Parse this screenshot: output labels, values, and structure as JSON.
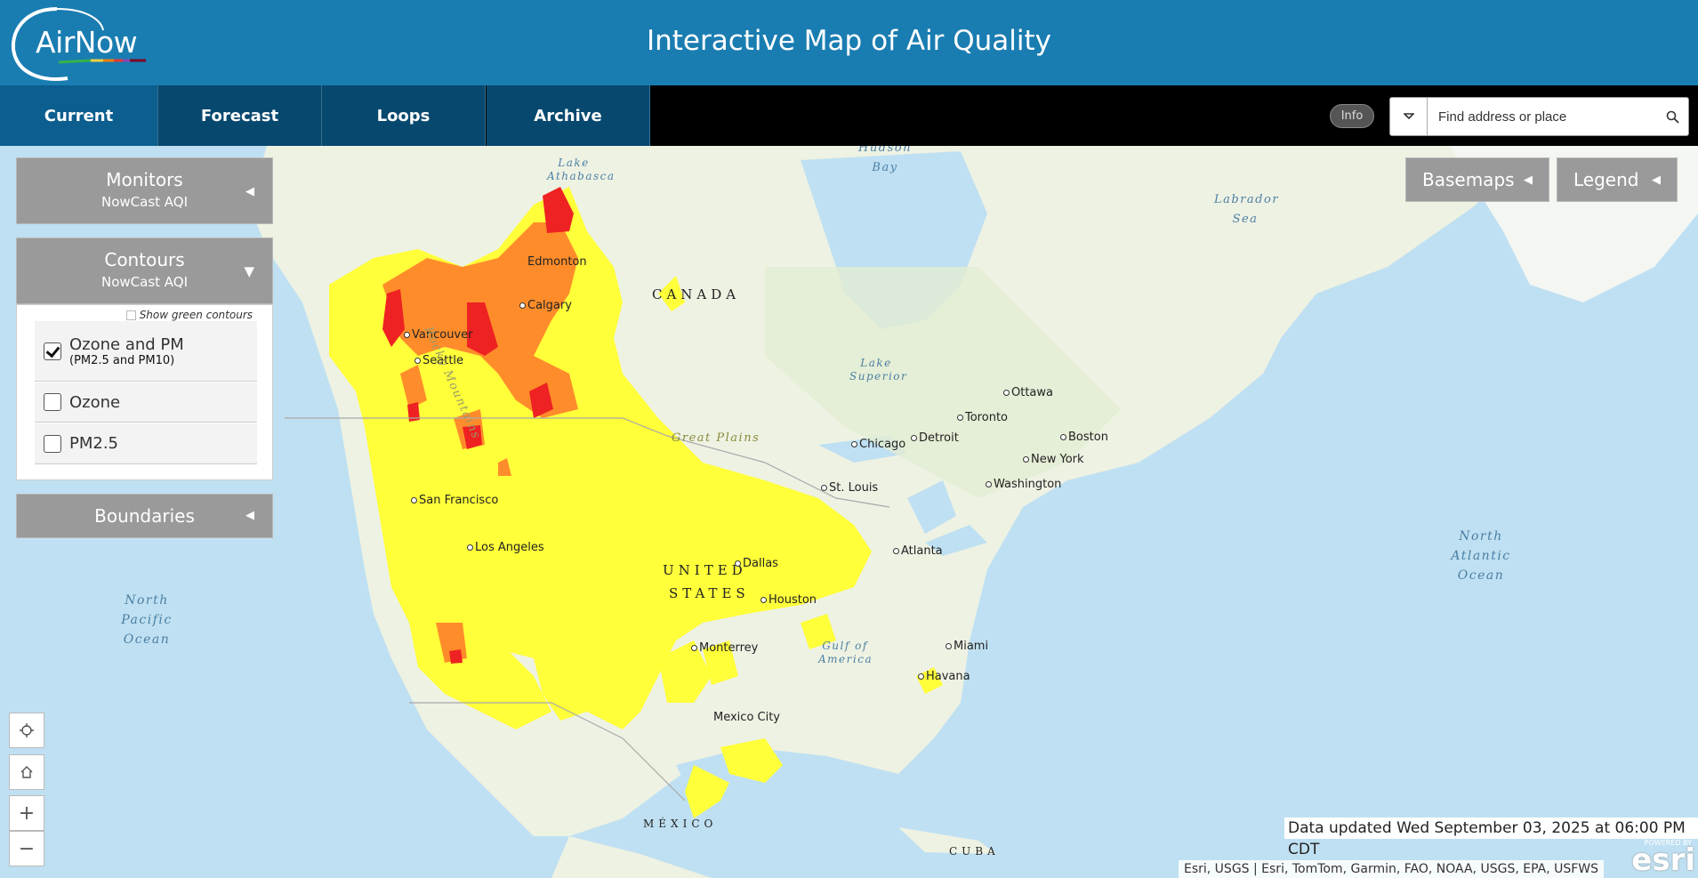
{
  "header": {
    "logo_text": "AirNow",
    "title": "Interactive Map of Air Quality"
  },
  "nav": {
    "tabs": [
      {
        "label": "Current",
        "active": true
      },
      {
        "label": "Forecast",
        "active": false
      },
      {
        "label": "Loops",
        "active": false
      },
      {
        "label": "Archive",
        "active": false
      }
    ],
    "info_label": "Info",
    "search_placeholder": "Find address or place"
  },
  "panels": {
    "monitors": {
      "title": "Monitors",
      "subtitle": "NowCast AQI"
    },
    "contours": {
      "title": "Contours",
      "subtitle": "NowCast AQI",
      "green_contours_label": "Show green contours",
      "options": [
        {
          "label": "Ozone and PM",
          "sub": "(PM2.5 and PM10)",
          "checked": true
        },
        {
          "label": "Ozone",
          "checked": false
        },
        {
          "label": "PM2.5",
          "checked": false
        }
      ]
    },
    "boundaries": {
      "title": "Boundaries"
    }
  },
  "map_buttons": {
    "basemaps": "Basemaps",
    "legend": "Legend"
  },
  "map_labels": {
    "countries": [
      "CANADA",
      "UNITED",
      "STATES",
      "MÉXICO",
      "CUBA"
    ],
    "cities": [
      "Edmonton",
      "Calgary",
      "Vancouver",
      "Seattle",
      "San Francisco",
      "Los Angeles",
      "Dallas",
      "Houston",
      "Monterrey",
      "Mexico City",
      "Chicago",
      "Detroit",
      "Toronto",
      "Ottawa",
      "Boston",
      "New York",
      "Washington",
      "St. Louis",
      "Atlanta",
      "Miami",
      "Havana"
    ],
    "water": [
      "Hudson Bay",
      "Labrador Sea",
      "Lake Superior",
      "Lake Athabasca",
      "Gulf of America",
      "North Pacific Ocean",
      "North Atlantic Ocean"
    ],
    "regions": [
      "Great Plains",
      "Rocky Mountains"
    ]
  },
  "status": {
    "updated": "Data updated Wed September 03, 2025 at 06:00 PM CDT",
    "attribution": "Esri, USGS | Esri, TomTom, Garmin, FAO, NOAA, USGS, EPA, USFWS",
    "esri_powered": "POWERED BY",
    "esri_name": "esri"
  },
  "colors": {
    "header_bg": "#1a7db1",
    "nav_bg": "#07486f",
    "aqi_moderate": "#ffff3a",
    "aqi_usg": "#ff8c2a",
    "aqi_unhealthy": "#ee2222"
  }
}
